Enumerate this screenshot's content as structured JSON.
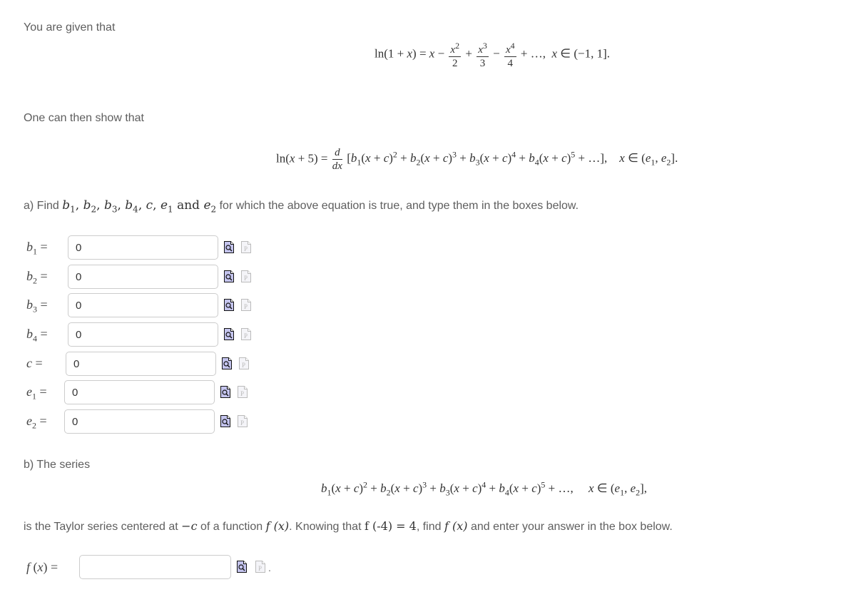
{
  "intro": {
    "given_text": "You are given that",
    "given_equation": {
      "lhs": "ln(1 + x) =",
      "terms": [
        "x −",
        "x^2/2",
        "+",
        "x^3/3",
        "−",
        "x^4/4",
        "+ …,"
      ],
      "domain": "x ∈ (−1, 1]."
    },
    "show_text": "One can then show that",
    "show_equation": {
      "lhs": "ln(x + 5) =",
      "derivative": "d/dx",
      "series": "[b₁(x + c)² + b₂(x + c)³ + b₃(x + c)⁴ + b₄(x + c)⁵ + …],",
      "domain": "x ∈ (e₁, e₂]."
    }
  },
  "part_a": {
    "prompt_prefix": "a) Find",
    "prompt_vars": "b₁, b₂, b₃, b₄, c, e₁",
    "prompt_and": "and",
    "prompt_var_last": "e₂",
    "prompt_suffix": "for which the above equation is true, and type them in the boxes below.",
    "fields": [
      {
        "var": "b",
        "sub": "1",
        "label_suffix": " =",
        "value": "0"
      },
      {
        "var": "b",
        "sub": "2",
        "label_suffix": " =",
        "value": "0"
      },
      {
        "var": "b",
        "sub": "3",
        "label_suffix": " =",
        "value": "0"
      },
      {
        "var": "b",
        "sub": "4",
        "label_suffix": " =",
        "value": "0"
      },
      {
        "var": "c",
        "sub": "",
        "label_suffix": " =",
        "value": "0"
      },
      {
        "var": "e",
        "sub": "1",
        "label_suffix": " =",
        "value": "0"
      },
      {
        "var": "e",
        "sub": "2",
        "label_suffix": " =",
        "value": "0"
      }
    ]
  },
  "part_b": {
    "intro": "b) The series",
    "series": "b₁(x + c)² + b₂(x + c)³ + b₃(x + c)⁴ + b₄(x + c)⁵ + …,",
    "domain": "x ∈ (e₁, e₂],",
    "prompt_1": "is the Taylor series centered at",
    "prompt_center": "−c",
    "prompt_2": "of a function",
    "prompt_fx": "f (x)",
    "prompt_3": ". Knowing that",
    "prompt_cond": "f (-4) = 4",
    "prompt_4": ", find",
    "prompt_fx2": "f (x)",
    "prompt_5": "and enter your answer in the box below.",
    "answer_label": "f (x) =",
    "answer_value": ""
  },
  "icons": {
    "preview": "preview-icon",
    "paste": "paste-icon"
  },
  "colors": {
    "preview_fill": "#c4c4ee",
    "paste_fill": "#f4f4f8",
    "input_border": "#cccccc",
    "text": "#5e5e5e"
  }
}
